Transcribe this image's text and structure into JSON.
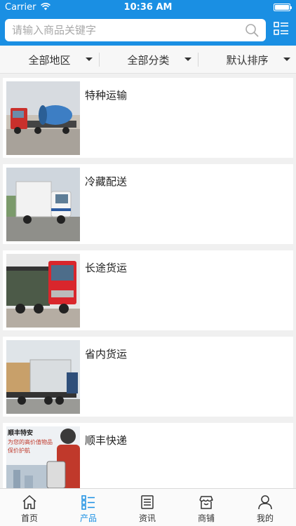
{
  "status_bar": {
    "carrier": "Carrier",
    "time": "10:36 AM"
  },
  "search": {
    "placeholder": "请输入商品关键字"
  },
  "filters": [
    {
      "label": "全部地区"
    },
    {
      "label": "全部分类"
    },
    {
      "label": "默认排序"
    }
  ],
  "products": [
    {
      "title": "特种运输"
    },
    {
      "title": "冷藏配送"
    },
    {
      "title": "长途货运"
    },
    {
      "title": "省内货运"
    },
    {
      "title": "顺丰快递",
      "image_text": [
        "顺丰特安",
        "为您的高价值物品",
        "保价护航"
      ]
    }
  ],
  "tabs": [
    {
      "label": "首页",
      "icon": "home-icon"
    },
    {
      "label": "产品",
      "icon": "grid-list-icon",
      "active": true
    },
    {
      "label": "资讯",
      "icon": "news-icon"
    },
    {
      "label": "商铺",
      "icon": "store-icon"
    },
    {
      "label": "我的",
      "icon": "user-icon"
    }
  ],
  "colors": {
    "accent": "#1a8fe3",
    "background": "#f0f0f0"
  }
}
